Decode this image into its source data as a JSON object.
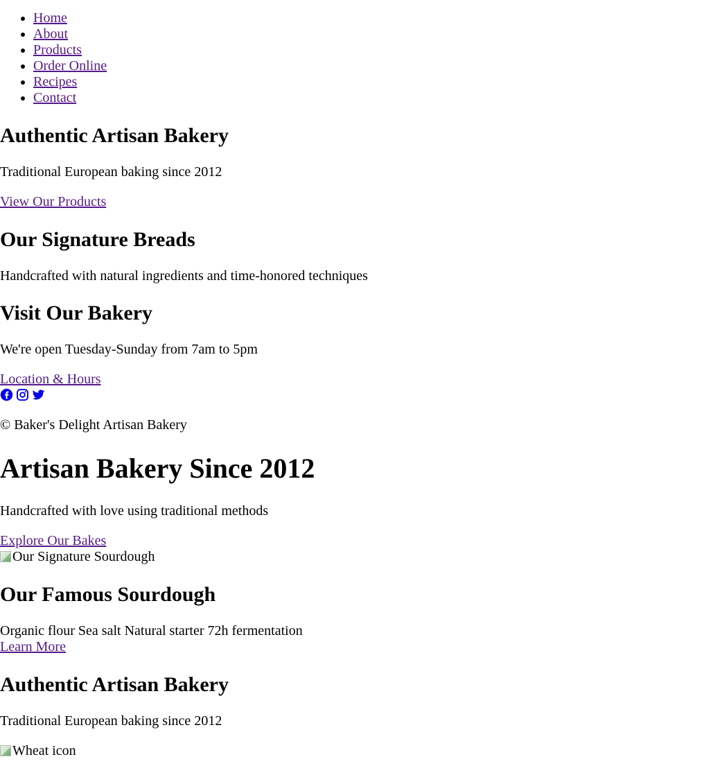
{
  "nav": {
    "items": [
      {
        "label": "Home"
      },
      {
        "label": "About"
      },
      {
        "label": "Products"
      },
      {
        "label": "Order Online"
      },
      {
        "label": "Recipes"
      },
      {
        "label": "Contact"
      }
    ]
  },
  "hero1": {
    "title": "Authentic Artisan Bakery",
    "subtitle": "Traditional European baking since 2012",
    "cta": "View Our Products"
  },
  "signature": {
    "title": "Our Signature Breads",
    "text": "Handcrafted with natural ingredients and time-honored techniques"
  },
  "visit": {
    "title": "Visit Our Bakery",
    "text": "We're open Tuesday-Sunday from 7am to 5pm",
    "link": "Location & Hours"
  },
  "social": {
    "icons": [
      "facebook-icon",
      "instagram-icon",
      "twitter-icon"
    ],
    "color": "#0000ee"
  },
  "footer": {
    "copyright": "© Baker's Delight Artisan Bakery"
  },
  "hero2": {
    "title": "Artisan Bakery Since 2012",
    "subtitle": "Handcrafted with love using traditional methods",
    "cta": "Explore Our Bakes"
  },
  "sourdough": {
    "image_alt": "Our Signature Sourdough",
    "title": "Our Famous Sourdough",
    "features": "Organic flour Sea salt Natural starter 72h fermentation",
    "link": "Learn More"
  },
  "hero3": {
    "title": "Authentic Artisan Bakery",
    "subtitle": "Traditional European baking since 2012",
    "image_alt": "Wheat icon"
  }
}
